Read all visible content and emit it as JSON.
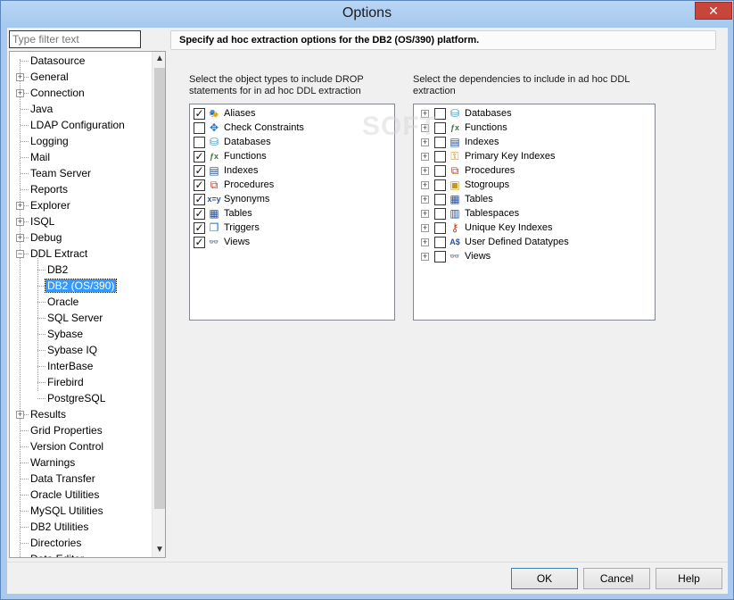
{
  "window": {
    "title": "Options",
    "close_label": "✕"
  },
  "filter": {
    "placeholder": "Type filter text"
  },
  "tree": {
    "items": [
      {
        "label": "Datasource",
        "level": 0,
        "expander": false
      },
      {
        "label": "General",
        "level": 0,
        "expander": true
      },
      {
        "label": "Connection",
        "level": 0,
        "expander": true
      },
      {
        "label": "Java",
        "level": 0,
        "expander": false
      },
      {
        "label": "LDAP Configuration",
        "level": 0,
        "expander": false
      },
      {
        "label": "Logging",
        "level": 0,
        "expander": false
      },
      {
        "label": "Mail",
        "level": 0,
        "expander": false
      },
      {
        "label": "Team Server",
        "level": 0,
        "expander": false
      },
      {
        "label": "Reports",
        "level": 0,
        "expander": false
      },
      {
        "label": "Explorer",
        "level": 0,
        "expander": true
      },
      {
        "label": "ISQL",
        "level": 0,
        "expander": true
      },
      {
        "label": "Debug",
        "level": 0,
        "expander": true
      },
      {
        "label": "DDL Extract",
        "level": 0,
        "expander": true,
        "expanded": true
      },
      {
        "label": "DB2",
        "level": 1,
        "expander": false
      },
      {
        "label": "DB2 (OS/390)",
        "level": 1,
        "expander": false,
        "selected": true
      },
      {
        "label": "Oracle",
        "level": 1,
        "expander": false
      },
      {
        "label": "SQL Server",
        "level": 1,
        "expander": false
      },
      {
        "label": "Sybase",
        "level": 1,
        "expander": false
      },
      {
        "label": "Sybase IQ",
        "level": 1,
        "expander": false
      },
      {
        "label": "InterBase",
        "level": 1,
        "expander": false
      },
      {
        "label": "Firebird",
        "level": 1,
        "expander": false
      },
      {
        "label": "PostgreSQL",
        "level": 1,
        "expander": false
      },
      {
        "label": "Results",
        "level": 0,
        "expander": true
      },
      {
        "label": "Grid Properties",
        "level": 0,
        "expander": false
      },
      {
        "label": "Version Control",
        "level": 0,
        "expander": false
      },
      {
        "label": "Warnings",
        "level": 0,
        "expander": false
      },
      {
        "label": "Data Transfer",
        "level": 0,
        "expander": false
      },
      {
        "label": "Oracle Utilities",
        "level": 0,
        "expander": false
      },
      {
        "label": "MySQL Utilities",
        "level": 0,
        "expander": false
      },
      {
        "label": "DB2 Utilities",
        "level": 0,
        "expander": false
      },
      {
        "label": "Directories",
        "level": 0,
        "expander": false
      },
      {
        "label": "Data Editor",
        "level": 0,
        "expander": false
      }
    ]
  },
  "header": {
    "text": "Specify ad hoc extraction options for the DB2 (OS/390) platform."
  },
  "drop_panel": {
    "description_line1": "Select the object types to include DROP",
    "description_line2": "statements for in ad hoc DDL extraction",
    "items": [
      {
        "label": "Aliases",
        "checked": true,
        "icon": "alias-icon",
        "glyph": "🎭",
        "color": "#b5651d"
      },
      {
        "label": "Check Constraints",
        "checked": false,
        "icon": "check-constraint-icon",
        "glyph": "✥",
        "color": "#2a6fb8"
      },
      {
        "label": "Databases",
        "checked": false,
        "icon": "database-icon",
        "glyph": "⛁",
        "color": "#2a8fb8"
      },
      {
        "label": "Functions",
        "checked": true,
        "icon": "function-icon",
        "glyph": "ƒx",
        "color": "#3a7a2a"
      },
      {
        "label": "Indexes",
        "checked": true,
        "icon": "index-icon",
        "glyph": "▤",
        "color": "#2a4f9a"
      },
      {
        "label": "Procedures",
        "checked": true,
        "icon": "procedure-icon",
        "glyph": "⧉",
        "color": "#c03a20"
      },
      {
        "label": "Synonyms",
        "checked": true,
        "icon": "synonym-icon",
        "glyph": "x=y",
        "color": "#2a4f9a"
      },
      {
        "label": "Tables",
        "checked": true,
        "icon": "table-icon",
        "glyph": "▦",
        "color": "#2a4f9a"
      },
      {
        "label": "Triggers",
        "checked": true,
        "icon": "trigger-icon",
        "glyph": "❐",
        "color": "#2a6fb8"
      },
      {
        "label": "Views",
        "checked": true,
        "icon": "view-icon",
        "glyph": "👓",
        "color": "#2a4f9a"
      }
    ]
  },
  "deps_panel": {
    "description_line1": "Select the dependencies to include in ad hoc DDL",
    "description_line2": "extraction",
    "items": [
      {
        "label": "Databases",
        "checked": false,
        "icon": "database-icon",
        "glyph": "⛁",
        "color": "#2a8fb8"
      },
      {
        "label": "Functions",
        "checked": false,
        "icon": "function-icon",
        "glyph": "ƒx",
        "color": "#3a7a2a"
      },
      {
        "label": "Indexes",
        "checked": false,
        "icon": "index-icon",
        "glyph": "▤",
        "color": "#2a4f9a"
      },
      {
        "label": "Primary Key Indexes",
        "checked": false,
        "icon": "key-icon",
        "glyph": "⚿",
        "color": "#c08a20"
      },
      {
        "label": "Procedures",
        "checked": false,
        "icon": "procedure-icon",
        "glyph": "⧉",
        "color": "#c03a20"
      },
      {
        "label": "Stogroups",
        "checked": false,
        "icon": "stogroup-icon",
        "glyph": "▣",
        "color": "#c89a10"
      },
      {
        "label": "Tables",
        "checked": false,
        "icon": "table-icon",
        "glyph": "▦",
        "color": "#2a4f9a"
      },
      {
        "label": "Tablespaces",
        "checked": false,
        "icon": "tablespace-icon",
        "glyph": "▥",
        "color": "#2a4f9a"
      },
      {
        "label": "Unique Key Indexes",
        "checked": false,
        "icon": "unique-key-icon",
        "glyph": "⚷",
        "color": "#c03a20"
      },
      {
        "label": "User Defined Datatypes",
        "checked": false,
        "icon": "datatype-icon",
        "glyph": "A$",
        "color": "#2a4f9a"
      },
      {
        "label": "Views",
        "checked": false,
        "icon": "view-icon",
        "glyph": "👓",
        "color": "#2a4f9a"
      }
    ]
  },
  "watermark": "SOFT",
  "footer": {
    "ok_label": "OK",
    "cancel_label": "Cancel",
    "help_label": "Help"
  }
}
